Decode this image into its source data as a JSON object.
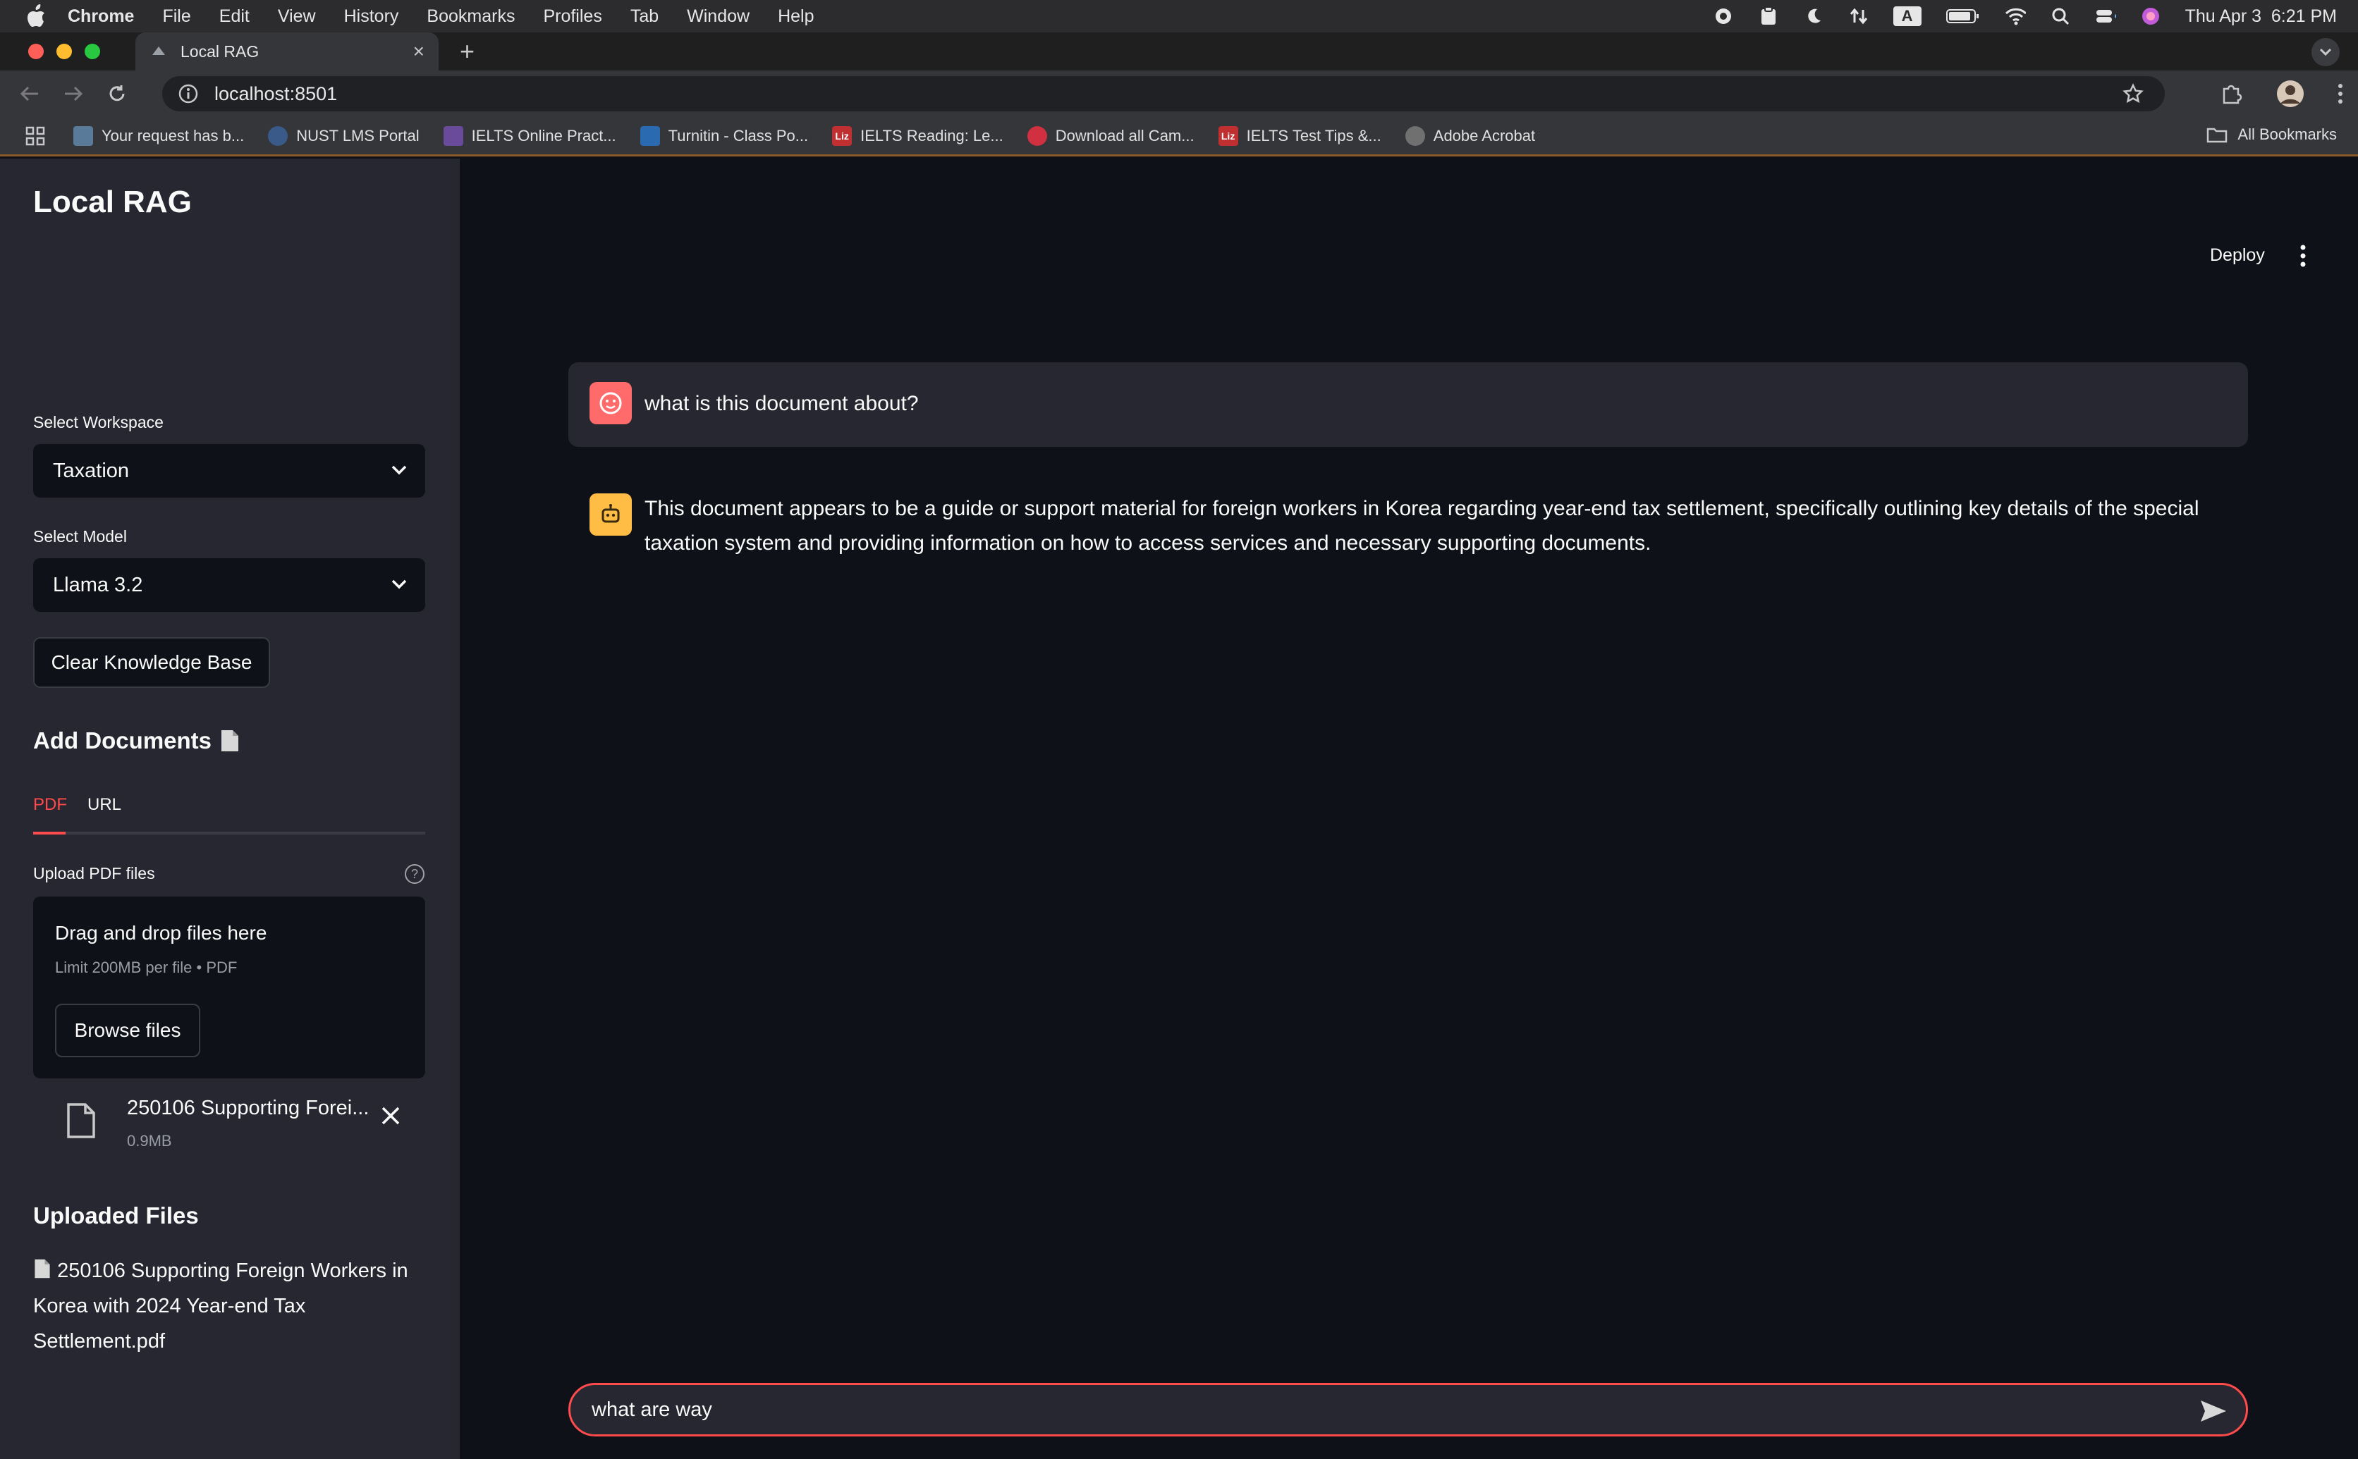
{
  "menubar": {
    "app": "Chrome",
    "items": [
      "File",
      "Edit",
      "View",
      "History",
      "Bookmarks",
      "Profiles",
      "Tab",
      "Window",
      "Help"
    ],
    "datetime": "Thu Apr 3  6:21 PM",
    "input_indicator": "A"
  },
  "browser": {
    "tab_title": "Local RAG",
    "url": "localhost:8501",
    "bookmarks": [
      {
        "label": "Your request has b...",
        "icon": "page-icon"
      },
      {
        "label": "NUST LMS Portal",
        "icon": "nust-icon"
      },
      {
        "label": "IELTS Online Pract...",
        "icon": "chart-icon"
      },
      {
        "label": "Turnitin - Class Po...",
        "icon": "turnitin-icon"
      },
      {
        "label": "IELTS Reading: Le...",
        "icon": "liz-icon"
      },
      {
        "label": "Download all Cam...",
        "icon": "red-icon"
      },
      {
        "label": "IELTS Test Tips &...",
        "icon": "liz-icon"
      },
      {
        "label": "Adobe Acrobat",
        "icon": "globe-icon"
      }
    ],
    "all_bookmarks": "All Bookmarks"
  },
  "sidebar": {
    "title": "Local RAG",
    "workspace_label": "Select Workspace",
    "workspace_value": "Taxation",
    "model_label": "Select Model",
    "model_value": "Llama 3.2",
    "clear_button": "Clear Knowledge Base",
    "add_docs_title": "Add Documents",
    "tabs": [
      "PDF",
      "URL"
    ],
    "active_tab": "PDF",
    "upload_label": "Upload PDF files",
    "dropzone_title": "Drag and drop files here",
    "dropzone_limit": "Limit 200MB per file • PDF",
    "browse_button": "Browse files",
    "file_name": "250106 Supporting Forei...",
    "file_size": "0.9MB",
    "uploaded_title": "Uploaded Files",
    "uploaded_file": "250106 Supporting Foreign Workers in Korea with 2024 Year-end Tax Settlement.pdf"
  },
  "main": {
    "deploy": "Deploy",
    "messages": [
      {
        "role": "user",
        "text": "what is this document about?"
      },
      {
        "role": "assistant",
        "text": "This document appears to be a guide or support material for foreign workers in Korea regarding year-end tax settlement, specifically outlining key details of the special taxation system and providing information on how to access services and necessary supporting documents."
      }
    ],
    "chat_input_value": "what are way"
  },
  "colors": {
    "accent": "#ff4b4b",
    "background": "#0e1117",
    "sidebar": "#262730",
    "assistant_avatar": "#ffbd45"
  }
}
